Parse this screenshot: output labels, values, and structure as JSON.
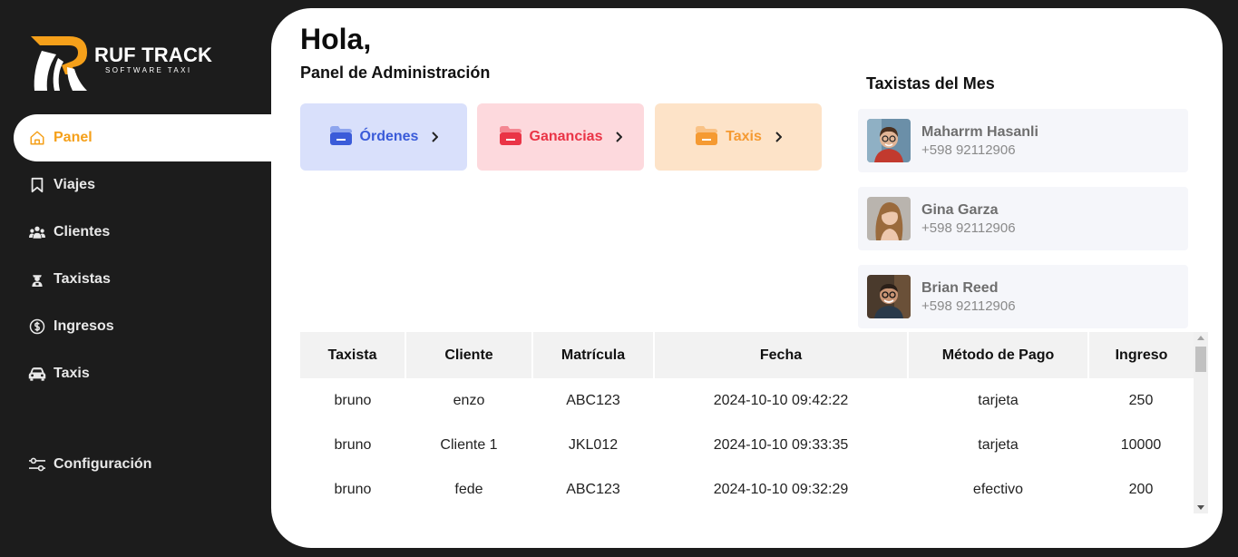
{
  "brand": {
    "name": "RUF TRACK",
    "tagline": "SOFTWARE TAXI",
    "accent": "#f5a01a"
  },
  "sidebar": {
    "items": [
      {
        "label": "Panel",
        "icon": "home-icon",
        "active": true
      },
      {
        "label": "Viajes",
        "icon": "bookmark-icon",
        "active": false
      },
      {
        "label": "Clientes",
        "icon": "users-icon",
        "active": false
      },
      {
        "label": "Taxistas",
        "icon": "driver-icon",
        "active": false
      },
      {
        "label": "Ingresos",
        "icon": "dollar-circle-icon",
        "active": false
      },
      {
        "label": "Taxis",
        "icon": "car-icon",
        "active": false
      }
    ],
    "config": {
      "label": "Configuración",
      "icon": "sliders-icon"
    }
  },
  "header": {
    "greeting": "Hola,",
    "subtitle": "Panel de Administración"
  },
  "cards": [
    {
      "label": "Órdenes",
      "color": "#3a5bd9"
    },
    {
      "label": "Ganancias",
      "color": "#ea3446"
    },
    {
      "label": "Taxis",
      "color": "#f59a32"
    }
  ],
  "top_drivers": {
    "title": "Taxistas del Mes",
    "items": [
      {
        "name": "Maharrm Hasanli",
        "phone": "+598 92112906"
      },
      {
        "name": "Gina Garza",
        "phone": "+598 92112906"
      },
      {
        "name": "Brian Reed",
        "phone": "+598 92112906"
      }
    ]
  },
  "table": {
    "headers": [
      "Taxista",
      "Cliente",
      "Matrícula",
      "Fecha",
      "Método de Pago",
      "Ingreso"
    ],
    "rows": [
      [
        "bruno",
        "enzo",
        "ABC123",
        "2024-10-10 09:42:22",
        "tarjeta",
        "250"
      ],
      [
        "bruno",
        "Cliente 1",
        "JKL012",
        "2024-10-10 09:33:35",
        "tarjeta",
        "10000"
      ],
      [
        "bruno",
        "fede",
        "ABC123",
        "2024-10-10 09:32:29",
        "efectivo",
        "200"
      ]
    ]
  }
}
